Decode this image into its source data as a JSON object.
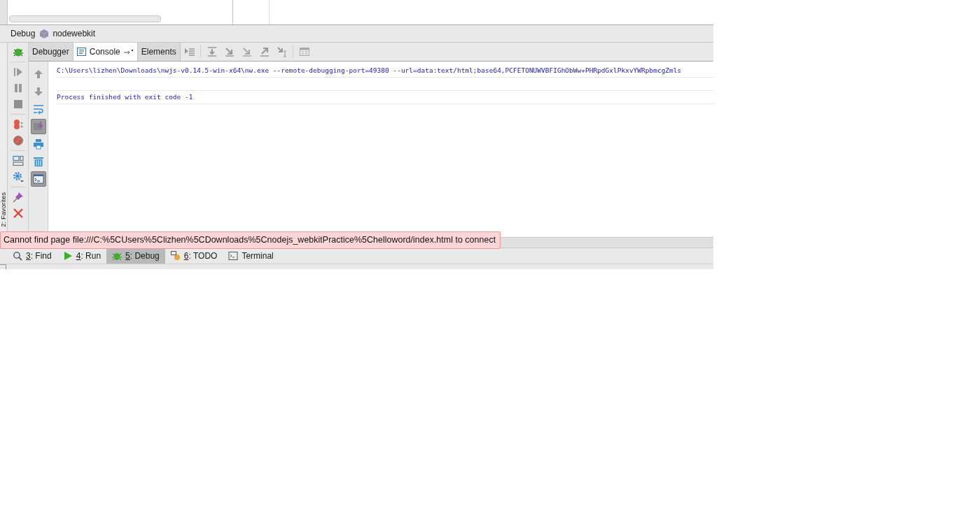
{
  "debug_panel": {
    "title": "Debug",
    "config_name": "nodewebkit",
    "tabs": [
      {
        "label": "Debugger",
        "selected": false
      },
      {
        "label": "Console",
        "selected": true
      },
      {
        "label": "Elements",
        "selected": false
      }
    ],
    "console_toolbar": [
      {
        "kind": "up",
        "on": false
      },
      {
        "kind": "down",
        "on": false
      },
      {
        "kind": "wrap",
        "on": false
      },
      {
        "kind": "scroll",
        "on": true
      },
      {
        "kind": "print",
        "on": false
      },
      {
        "kind": "trash",
        "on": false
      },
      {
        "kind": "terminal",
        "on": true
      }
    ],
    "console_lines": [
      {
        "kind": "text",
        "text": "C:\\Users\\lizhen\\Downloads\\nwjs-v0.14.5-win-x64\\nw.exe --remote-debugging-port=49380 --url=data:text/html;base64,PCFETONUWVBFIGhObWw+PHRpdGxlPkxvYWRpbmcgZmls"
      },
      {
        "kind": "blank"
      },
      {
        "kind": "text",
        "text": "Process finished with exit code -1"
      }
    ]
  },
  "favorites_label": "2: Favorites",
  "tooltip": "Cannot find page file:///C:%5CUsers%5Clizhen%5CDownloads%5Cnodejs_webkitPractice%5Chelloword/index.html to connect",
  "tool_windows": [
    {
      "mnemonic": "3",
      "label": ": Find",
      "kind": "find",
      "selected": false
    },
    {
      "mnemonic": "4",
      "label": ": Run",
      "kind": "run",
      "selected": false
    },
    {
      "mnemonic": "5",
      "label": ": Debug",
      "kind": "debug",
      "selected": true
    },
    {
      "mnemonic": "6",
      "label": ": TODO",
      "kind": "todo",
      "selected": false
    },
    {
      "label": "Terminal",
      "kind": "terminal",
      "selected": false
    }
  ]
}
